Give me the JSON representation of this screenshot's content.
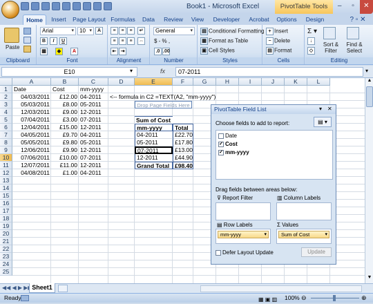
{
  "window": {
    "title": "Book1 - Microsoft Excel",
    "context_tab": "PivotTable Tools",
    "controls": [
      "–",
      "▫",
      "✕"
    ]
  },
  "tabs": [
    "Home",
    "Insert",
    "Page Layout",
    "Formulas",
    "Data",
    "Review",
    "View",
    "Developer",
    "Acrobat",
    "Options",
    "Design"
  ],
  "ribbon": {
    "clipboard": {
      "label": "Clipboard",
      "paste": "Paste"
    },
    "font": {
      "label": "Font",
      "name": "Arial",
      "size": "10"
    },
    "alignment": {
      "label": "Alignment"
    },
    "number": {
      "label": "Number",
      "format": "General",
      "sample": "$ - % ,"
    },
    "styles": {
      "label": "Styles",
      "cond": "Conditional Formatting",
      "table": "Format as Table",
      "cell": "Cell Styles"
    },
    "cells": {
      "label": "Cells",
      "insert": "Insert",
      "delete": "Delete",
      "format": "Format"
    },
    "editing": {
      "label": "Editing",
      "sort": "Sort & Filter",
      "find": "Find & Select"
    }
  },
  "formula_bar": {
    "name_box": "E10",
    "fx": "fx",
    "value": "07-2011"
  },
  "columns": [
    "A",
    "B",
    "C",
    "D",
    "E",
    "F",
    "G",
    "H",
    "I",
    "J",
    "K",
    "L"
  ],
  "rows": [
    "1",
    "2",
    "3",
    "4",
    "5",
    "6",
    "7",
    "8",
    "9",
    "10",
    "11",
    "12",
    "13",
    "14",
    "15",
    "16",
    "17",
    "18",
    "19",
    "20",
    "21",
    "22",
    "23",
    "24",
    "25"
  ],
  "cells": {
    "headers": {
      "date": "Date",
      "cost": "Cost",
      "mm": "mm-yyyy"
    },
    "data": [
      {
        "date": "04/03/2011",
        "cost": "£12.00",
        "mm": "04-2011"
      },
      {
        "date": "05/03/2011",
        "cost": "£8.00",
        "mm": "05-2011"
      },
      {
        "date": "12/03/2011",
        "cost": "£9.00",
        "mm": "12-2011"
      },
      {
        "date": "07/04/2011",
        "cost": "£3.00",
        "mm": "07-2011"
      },
      {
        "date": "12/04/2011",
        "cost": "£15.00",
        "mm": "12-2011"
      },
      {
        "date": "04/05/2011",
        "cost": "£9.70",
        "mm": "04-2011"
      },
      {
        "date": "05/05/2011",
        "cost": "£9.80",
        "mm": "05-2011"
      },
      {
        "date": "12/06/2011",
        "cost": "£9.90",
        "mm": "12-2011"
      },
      {
        "date": "07/06/2011",
        "cost": "£10.00",
        "mm": "07-2011"
      },
      {
        "date": "12/07/2011",
        "cost": "£11.00",
        "mm": "12-2011"
      },
      {
        "date": "04/08/2011",
        "cost": "£1.00",
        "mm": "04-2011"
      }
    ],
    "note": "<-- formula in C2 =TEXT(A2, \"mm-yyyy\")"
  },
  "pivot": {
    "drop_page": "Drop Page Fields Here",
    "title": "Sum of Cost",
    "row_header": "mm-yyyy",
    "total_header": "Total",
    "rows": [
      {
        "k": "04-2011",
        "v": "£22.70"
      },
      {
        "k": "05-2011",
        "v": "£17.80"
      },
      {
        "k": "07-2011",
        "v": "£13.00"
      },
      {
        "k": "12-2011",
        "v": "£44.90"
      }
    ],
    "grand_label": "Grand Total",
    "grand_value": "£98.40"
  },
  "field_list": {
    "title": "PivotTable Field List",
    "choose": "Choose fields to add to report:",
    "fields": [
      {
        "name": "Date",
        "checked": false
      },
      {
        "name": "Cost",
        "checked": true
      },
      {
        "name": "mm-yyyy",
        "checked": true
      }
    ],
    "drag": "Drag fields between areas below:",
    "report_filter": "Report Filter",
    "column_labels": "Column Labels",
    "row_labels": "Row Labels",
    "values": "Values",
    "row_pill": "mm-yyyy",
    "value_pill": "Sum of Cost",
    "defer": "Defer Layout Update",
    "update": "Update"
  },
  "sheet_tab": "Sheet1",
  "status": {
    "left": "Ready",
    "zoom": "100%"
  }
}
